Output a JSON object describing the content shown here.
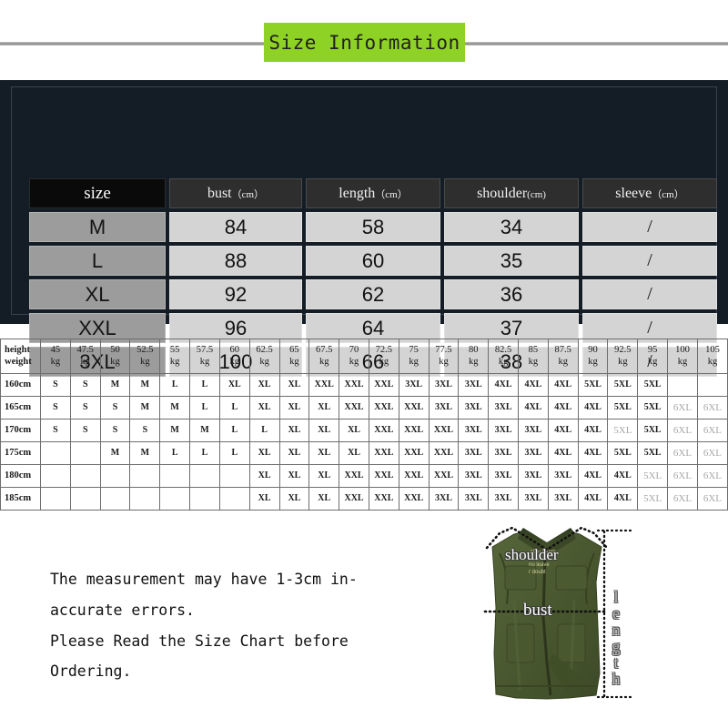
{
  "title": {
    "text": "Size Information"
  },
  "size_table": {
    "headers": [
      {
        "label": "size",
        "unit": ""
      },
      {
        "label": "bust",
        "unit": "（cm）"
      },
      {
        "label": "length",
        "unit": "（cm）"
      },
      {
        "label": "shoulder",
        "unit": "(cm)"
      },
      {
        "label": "sleeve",
        "unit": "（cm）"
      }
    ],
    "rows": [
      {
        "size": "M",
        "bust": "84",
        "length": "58",
        "shoulder": "34",
        "sleeve": "/"
      },
      {
        "size": "L",
        "bust": "88",
        "length": "60",
        "shoulder": "35",
        "sleeve": "/"
      },
      {
        "size": "XL",
        "bust": "92",
        "length": "62",
        "shoulder": "36",
        "sleeve": "/"
      },
      {
        "size": "XXL",
        "bust": "96",
        "length": "64",
        "shoulder": "37",
        "sleeve": "/"
      },
      {
        "size": "3XL",
        "bust": "100",
        "length": "66",
        "shoulder": "38",
        "sleeve": "/"
      }
    ]
  },
  "hw_table": {
    "corner_top": "height",
    "corner_bottom": "weight",
    "unit": "kg",
    "weights": [
      "45",
      "47.5",
      "50",
      "52.5",
      "55",
      "57.5",
      "60",
      "62.5",
      "65",
      "67.5",
      "70",
      "72.5",
      "75",
      "77.5",
      "80",
      "82.5",
      "85",
      "87.5",
      "90",
      "92.5",
      "95",
      "100",
      "105"
    ],
    "rows": [
      {
        "height": "160cm",
        "cells": [
          {
            "v": "S"
          },
          {
            "v": "S"
          },
          {
            "v": "M"
          },
          {
            "v": "M"
          },
          {
            "v": "L"
          },
          {
            "v": "L"
          },
          {
            "v": "XL"
          },
          {
            "v": "XL"
          },
          {
            "v": "XL"
          },
          {
            "v": "XXL",
            "wrap": true
          },
          {
            "v": "XXL"
          },
          {
            "v": "XXL"
          },
          {
            "v": "3XL"
          },
          {
            "v": "3XL"
          },
          {
            "v": "3XL"
          },
          {
            "v": "4XL"
          },
          {
            "v": "4XL"
          },
          {
            "v": "4XL"
          },
          {
            "v": "5XL"
          },
          {
            "v": "5XL"
          },
          {
            "v": "5XL"
          },
          {
            "v": ""
          },
          {
            "v": ""
          }
        ]
      },
      {
        "height": "165cm",
        "cells": [
          {
            "v": "S"
          },
          {
            "v": "S"
          },
          {
            "v": "S"
          },
          {
            "v": "M"
          },
          {
            "v": "M"
          },
          {
            "v": "L"
          },
          {
            "v": "L"
          },
          {
            "v": "XL"
          },
          {
            "v": "XL"
          },
          {
            "v": "XL"
          },
          {
            "v": "XXL"
          },
          {
            "v": "XXL"
          },
          {
            "v": "XXL"
          },
          {
            "v": "3XL"
          },
          {
            "v": "3XL"
          },
          {
            "v": "3XL"
          },
          {
            "v": "4XL"
          },
          {
            "v": "4XL"
          },
          {
            "v": "4XL"
          },
          {
            "v": "5XL"
          },
          {
            "v": "5XL"
          },
          {
            "v": "6XL",
            "faded": true
          },
          {
            "v": "6XL",
            "faded": true
          }
        ]
      },
      {
        "height": "170cm",
        "cells": [
          {
            "v": "S"
          },
          {
            "v": "S"
          },
          {
            "v": "S"
          },
          {
            "v": "S"
          },
          {
            "v": "M"
          },
          {
            "v": "M"
          },
          {
            "v": "L"
          },
          {
            "v": "L"
          },
          {
            "v": "XL"
          },
          {
            "v": "XL"
          },
          {
            "v": "XL"
          },
          {
            "v": "XXL"
          },
          {
            "v": "XXL"
          },
          {
            "v": "XXL"
          },
          {
            "v": "3XL"
          },
          {
            "v": "3XL"
          },
          {
            "v": "3XL"
          },
          {
            "v": "4XL"
          },
          {
            "v": "4XL"
          },
          {
            "v": "5XL",
            "faded": true
          },
          {
            "v": "5XL"
          },
          {
            "v": "6XL",
            "faded": true
          },
          {
            "v": "6XL",
            "faded": true
          }
        ]
      },
      {
        "height": "175cm",
        "cells": [
          {
            "v": ""
          },
          {
            "v": ""
          },
          {
            "v": "M"
          },
          {
            "v": "M"
          },
          {
            "v": "L"
          },
          {
            "v": "L"
          },
          {
            "v": "L"
          },
          {
            "v": "XL"
          },
          {
            "v": "XL"
          },
          {
            "v": "XL"
          },
          {
            "v": "XL"
          },
          {
            "v": "XXL"
          },
          {
            "v": "XXL"
          },
          {
            "v": "XXL"
          },
          {
            "v": "3XL"
          },
          {
            "v": "3XL"
          },
          {
            "v": "3XL"
          },
          {
            "v": "4XL"
          },
          {
            "v": "4XL"
          },
          {
            "v": "5XL"
          },
          {
            "v": "5XL"
          },
          {
            "v": "6XL",
            "faded": true
          },
          {
            "v": "6XL",
            "faded": true
          }
        ]
      },
      {
        "height": "180cm",
        "cells": [
          {
            "v": ""
          },
          {
            "v": ""
          },
          {
            "v": ""
          },
          {
            "v": ""
          },
          {
            "v": ""
          },
          {
            "v": ""
          },
          {
            "v": ""
          },
          {
            "v": "XL"
          },
          {
            "v": "XL"
          },
          {
            "v": "XL"
          },
          {
            "v": "XXL"
          },
          {
            "v": "XXL"
          },
          {
            "v": "XXL"
          },
          {
            "v": "XXL"
          },
          {
            "v": "3XL"
          },
          {
            "v": "3XL"
          },
          {
            "v": "3XL"
          },
          {
            "v": "3XL"
          },
          {
            "v": "4XL"
          },
          {
            "v": "4XL"
          },
          {
            "v": "5XL",
            "faded": true
          },
          {
            "v": "6XL",
            "faded": true
          },
          {
            "v": "6XL",
            "faded": true
          }
        ]
      },
      {
        "height": "185cm",
        "cells": [
          {
            "v": ""
          },
          {
            "v": ""
          },
          {
            "v": ""
          },
          {
            "v": ""
          },
          {
            "v": ""
          },
          {
            "v": ""
          },
          {
            "v": ""
          },
          {
            "v": "XL"
          },
          {
            "v": "XL"
          },
          {
            "v": "XL"
          },
          {
            "v": "XXL"
          },
          {
            "v": "XXL"
          },
          {
            "v": "XXL"
          },
          {
            "v": "3XL"
          },
          {
            "v": "3XL"
          },
          {
            "v": "3XL"
          },
          {
            "v": "3XL"
          },
          {
            "v": "3XL"
          },
          {
            "v": "4XL"
          },
          {
            "v": "4XL"
          },
          {
            "v": "5XL",
            "faded": true
          },
          {
            "v": "6XL",
            "faded": true
          },
          {
            "v": "6XL",
            "faded": true
          }
        ]
      }
    ]
  },
  "note": {
    "lines": [
      "The measurement may have 1-3cm in-",
      "accurate errors.",
      "Please Read the Size Chart before",
      "Ordering."
    ]
  },
  "garment": {
    "labels": {
      "shoulder": "shoulder",
      "bust": "bust",
      "length": "length"
    },
    "brand_line1": "stay tough",
    "brand_line2": "no leave",
    "brand_line3": "r doubt"
  },
  "colors": {
    "title_box": "#8ed225",
    "panel_bg": "#141c26",
    "size_header_bg": "#2e2e2e",
    "size_corner_bg": "#0a0a0a",
    "size_label_bg": "#9c9c9c",
    "value_bg": "#d4d4d4",
    "garment_green": "#4e5c33"
  }
}
